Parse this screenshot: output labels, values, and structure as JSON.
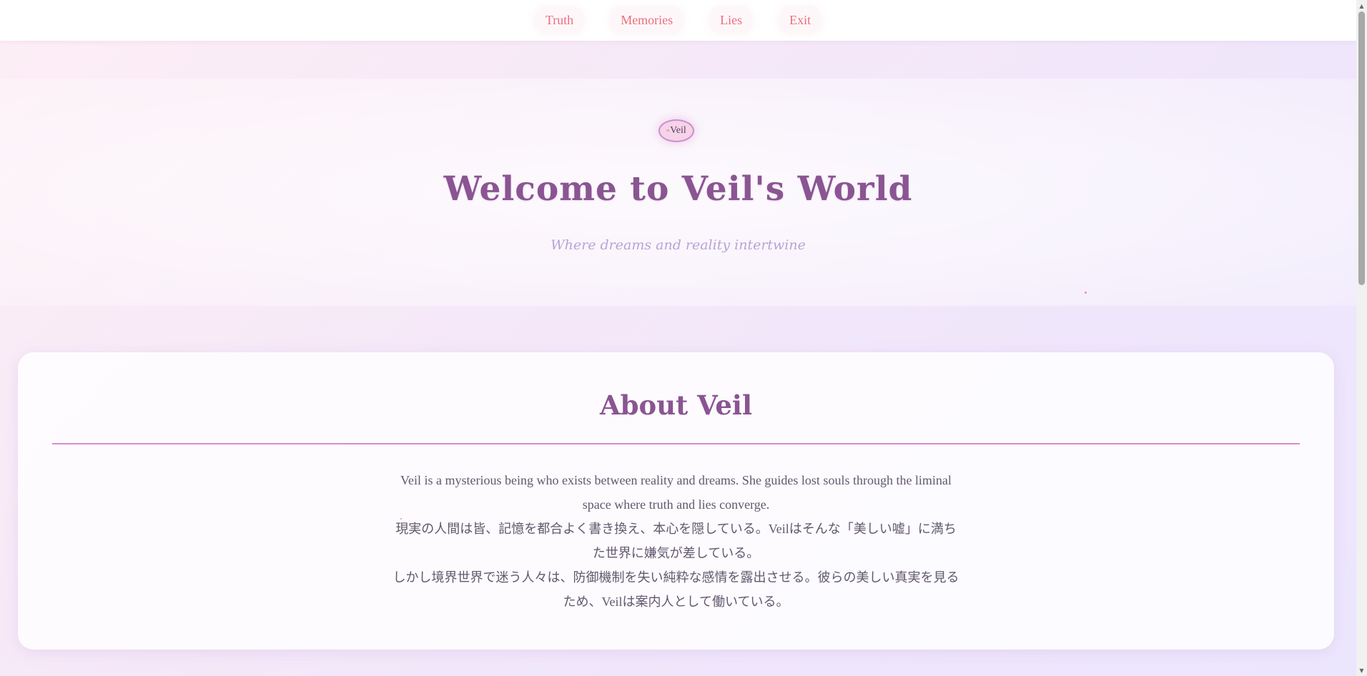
{
  "nav": {
    "items": [
      {
        "label": "Truth"
      },
      {
        "label": "Memories"
      },
      {
        "label": "Lies"
      },
      {
        "label": "Exit"
      }
    ]
  },
  "hero": {
    "avatar_alt": "Veil",
    "title": "Welcome to Veil's World",
    "subtitle": "Where dreams and reality intertwine"
  },
  "about": {
    "title": "About Veil",
    "paragraphs": [
      "Veil is a mysterious being who exists between reality and dreams. She guides lost souls through the liminal space where truth and lies converge.",
      "現実の人間は皆、記憶を都合よく書き換え、本心を隠している。Veilはそんな「美しい嘘」に満ちた世界に嫌気が差している。",
      "しかし境界世界で迷う人々は、防御機制を失い純粋な感情を露出させる。彼らの美しい真実を見るため、Veilは案内人として働いている。"
    ]
  },
  "colors": {
    "nav_link": "#ea6f7e",
    "heading": "#8a5592",
    "subtitle": "#b8a3d6",
    "divider": "#d98bd0",
    "body_text": "#62586e"
  },
  "icons": {
    "avatar": "broken-image-icon",
    "scroll_up": "arrow-up-icon",
    "scroll_down": "arrow-down-icon"
  }
}
